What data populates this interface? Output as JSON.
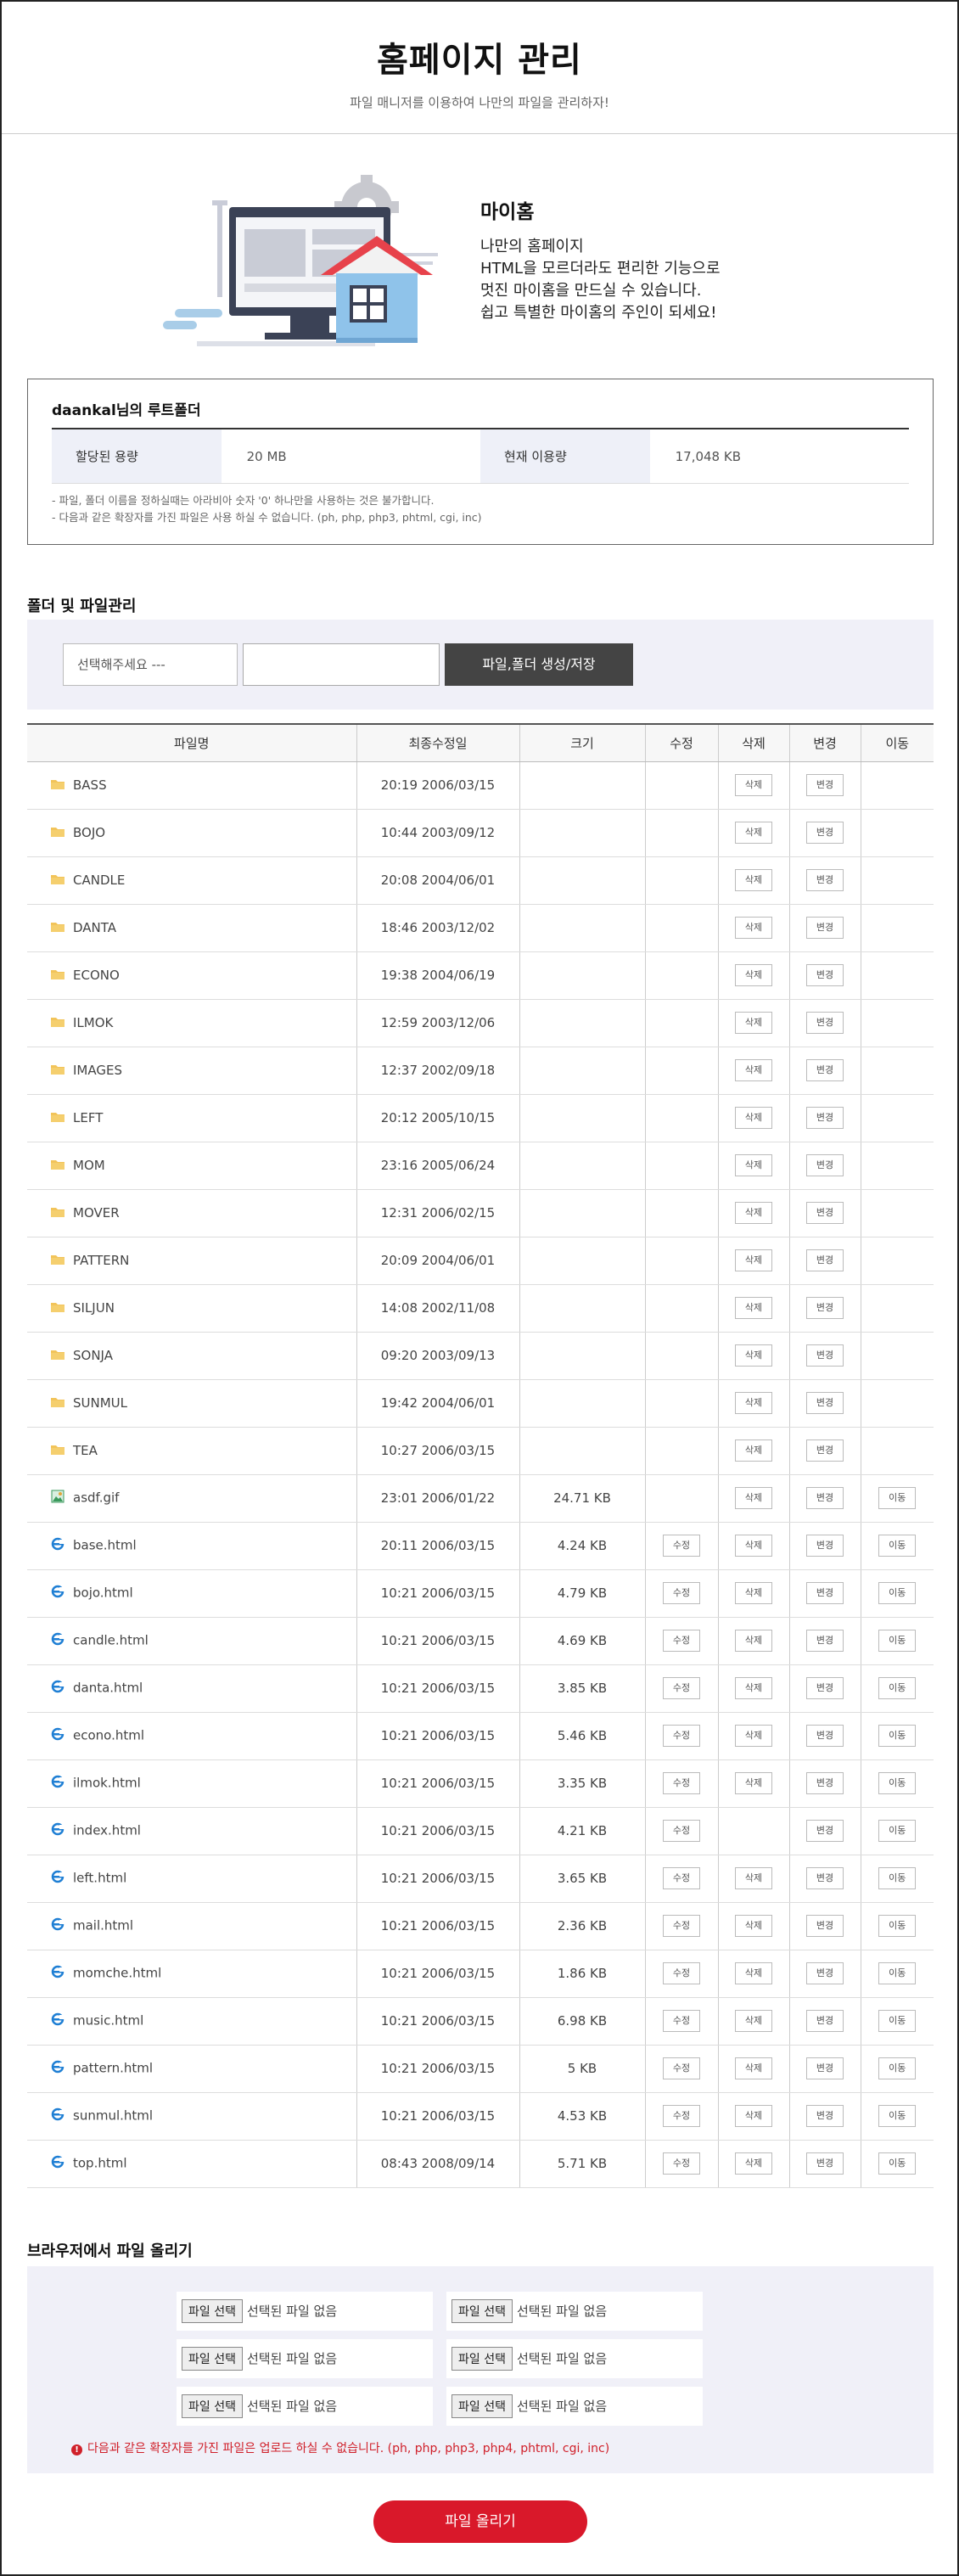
{
  "header": {
    "title": "홈페이지 관리",
    "subtitle": "파일 매니저를 이용하여 나만의 파일을 관리하자!"
  },
  "hero": {
    "title": "마이홈",
    "lines": [
      "나만의 홈페이지",
      "HTML을 모르더라도 편리한 기능으로",
      "멋진 마이홈을 만드실 수 있습니다.",
      "쉽고 특별한 마이홈의 주인이 되세요!"
    ]
  },
  "root": {
    "owner": "daankal",
    "owner_suffix": "님의 루트폴더",
    "quota_label": "할당된 용량",
    "quota_value": "20 MB",
    "usage_label": "현재 이용량",
    "usage_value": "17,048 KB",
    "notes": [
      "- 파일, 폴더 이름을 정하실때는 아라비아 숫자 '0' 하나만을 사용하는 것은 불가합니다.",
      "- 다음과 같은 확장자를 가진 파일은 사용 하실 수 없습니다. (ph, php, php3, phtml, cgi, inc)"
    ]
  },
  "manage": {
    "title": "폴더 및 파일관리",
    "select_placeholder": "선택해주세요 ---",
    "input_value": "",
    "create_button": "파일,폴더 생성/저장"
  },
  "table": {
    "headers": [
      "파일명",
      "최종수정일",
      "크기",
      "수정",
      "삭제",
      "변경",
      "이동"
    ],
    "edit_label": "수정",
    "delete_label": "삭제",
    "rename_label": "변경",
    "move_label": "이동",
    "rows": [
      {
        "name": "BASS",
        "date": "20:19 2006/03/15",
        "size": "",
        "type": "folder",
        "edit": false,
        "del": true,
        "ren": true,
        "move": false
      },
      {
        "name": "BOJO",
        "date": "10:44 2003/09/12",
        "size": "",
        "type": "folder",
        "edit": false,
        "del": true,
        "ren": true,
        "move": false
      },
      {
        "name": "CANDLE",
        "date": "20:08 2004/06/01",
        "size": "",
        "type": "folder",
        "edit": false,
        "del": true,
        "ren": true,
        "move": false
      },
      {
        "name": "DANTA",
        "date": "18:46 2003/12/02",
        "size": "",
        "type": "folder",
        "edit": false,
        "del": true,
        "ren": true,
        "move": false
      },
      {
        "name": "ECONO",
        "date": "19:38 2004/06/19",
        "size": "",
        "type": "folder",
        "edit": false,
        "del": true,
        "ren": true,
        "move": false
      },
      {
        "name": "ILMOK",
        "date": "12:59 2003/12/06",
        "size": "",
        "type": "folder",
        "edit": false,
        "del": true,
        "ren": true,
        "move": false
      },
      {
        "name": "IMAGES",
        "date": "12:37 2002/09/18",
        "size": "",
        "type": "folder",
        "edit": false,
        "del": true,
        "ren": true,
        "move": false
      },
      {
        "name": "LEFT",
        "date": "20:12 2005/10/15",
        "size": "",
        "type": "folder",
        "edit": false,
        "del": true,
        "ren": true,
        "move": false
      },
      {
        "name": "MOM",
        "date": "23:16 2005/06/24",
        "size": "",
        "type": "folder",
        "edit": false,
        "del": true,
        "ren": true,
        "move": false
      },
      {
        "name": "MOVER",
        "date": "12:31 2006/02/15",
        "size": "",
        "type": "folder",
        "edit": false,
        "del": true,
        "ren": true,
        "move": false
      },
      {
        "name": "PATTERN",
        "date": "20:09 2004/06/01",
        "size": "",
        "type": "folder",
        "edit": false,
        "del": true,
        "ren": true,
        "move": false
      },
      {
        "name": "SILJUN",
        "date": "14:08 2002/11/08",
        "size": "",
        "type": "folder",
        "edit": false,
        "del": true,
        "ren": true,
        "move": false
      },
      {
        "name": "SONJA",
        "date": "09:20 2003/09/13",
        "size": "",
        "type": "folder",
        "edit": false,
        "del": true,
        "ren": true,
        "move": false
      },
      {
        "name": "SUNMUL",
        "date": "19:42 2004/06/01",
        "size": "",
        "type": "folder",
        "edit": false,
        "del": true,
        "ren": true,
        "move": false
      },
      {
        "name": "TEA",
        "date": "10:27 2006/03/15",
        "size": "",
        "type": "folder",
        "edit": false,
        "del": true,
        "ren": true,
        "move": false
      },
      {
        "name": "asdf.gif",
        "date": "23:01 2006/01/22",
        "size": "24.71 KB",
        "type": "image",
        "edit": false,
        "del": true,
        "ren": true,
        "move": true
      },
      {
        "name": "base.html",
        "date": "20:11 2006/03/15",
        "size": "4.24 KB",
        "type": "html",
        "edit": true,
        "del": true,
        "ren": true,
        "move": true
      },
      {
        "name": "bojo.html",
        "date": "10:21 2006/03/15",
        "size": "4.79 KB",
        "type": "html",
        "edit": true,
        "del": true,
        "ren": true,
        "move": true
      },
      {
        "name": "candle.html",
        "date": "10:21 2006/03/15",
        "size": "4.69 KB",
        "type": "html",
        "edit": true,
        "del": true,
        "ren": true,
        "move": true
      },
      {
        "name": "danta.html",
        "date": "10:21 2006/03/15",
        "size": "3.85 KB",
        "type": "html",
        "edit": true,
        "del": true,
        "ren": true,
        "move": true
      },
      {
        "name": "econo.html",
        "date": "10:21 2006/03/15",
        "size": "5.46 KB",
        "type": "html",
        "edit": true,
        "del": true,
        "ren": true,
        "move": true
      },
      {
        "name": "ilmok.html",
        "date": "10:21 2006/03/15",
        "size": "3.35 KB",
        "type": "html",
        "edit": true,
        "del": true,
        "ren": true,
        "move": true
      },
      {
        "name": "index.html",
        "date": "10:21 2006/03/15",
        "size": "4.21 KB",
        "type": "html",
        "edit": true,
        "del": false,
        "ren": true,
        "move": true
      },
      {
        "name": "left.html",
        "date": "10:21 2006/03/15",
        "size": "3.65 KB",
        "type": "html",
        "edit": true,
        "del": true,
        "ren": true,
        "move": true
      },
      {
        "name": "mail.html",
        "date": "10:21 2006/03/15",
        "size": "2.36 KB",
        "type": "html",
        "edit": true,
        "del": true,
        "ren": true,
        "move": true
      },
      {
        "name": "momche.html",
        "date": "10:21 2006/03/15",
        "size": "1.86 KB",
        "type": "html",
        "edit": true,
        "del": true,
        "ren": true,
        "move": true
      },
      {
        "name": "music.html",
        "date": "10:21 2006/03/15",
        "size": "6.98 KB",
        "type": "html",
        "edit": true,
        "del": true,
        "ren": true,
        "move": true
      },
      {
        "name": "pattern.html",
        "date": "10:21 2006/03/15",
        "size": "5 KB",
        "type": "html",
        "edit": true,
        "del": true,
        "ren": true,
        "move": true
      },
      {
        "name": "sunmul.html",
        "date": "10:21 2006/03/15",
        "size": "4.53 KB",
        "type": "html",
        "edit": true,
        "del": true,
        "ren": true,
        "move": true
      },
      {
        "name": "top.html",
        "date": "08:43 2008/09/14",
        "size": "5.71 KB",
        "type": "html",
        "edit": true,
        "del": true,
        "ren": true,
        "move": true
      }
    ]
  },
  "upload": {
    "title": "브라우저에서 파일 올리기",
    "choose_label": "파일 선택",
    "no_file_label": "선택된 파일 없음",
    "field_count": 6,
    "note": "다음과 같은 확장자를 가진 파일은 업로드 하실 수 없습니다. (ph, php, php3, php4, phtml, cgi, inc)",
    "note_icon": "!",
    "submit_label": "파일 올리기"
  },
  "colors": {
    "accent": "#d9182a",
    "dark_button": "#444444",
    "panel_bg": "#f0f0f8",
    "folder": "#f2c45a"
  }
}
